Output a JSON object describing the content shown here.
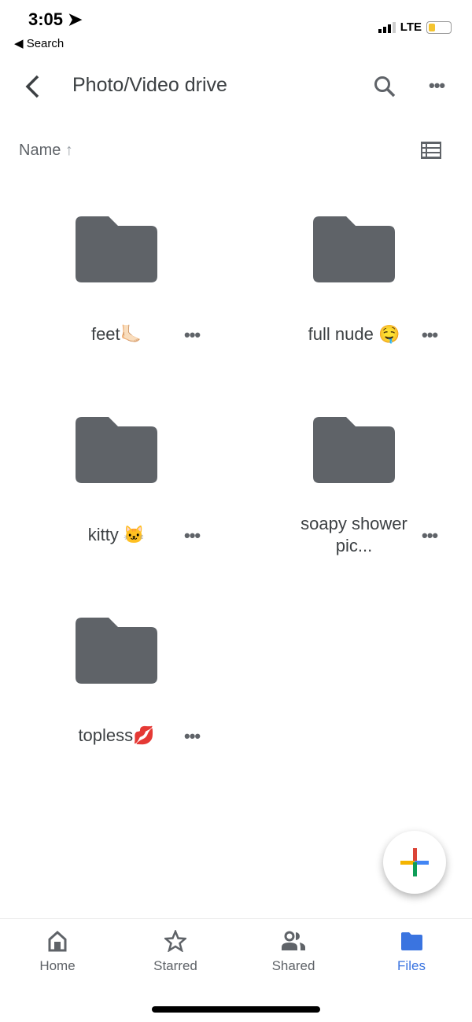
{
  "status_bar": {
    "time": "3:05",
    "back_app": "◀ Search",
    "network": "LTE",
    "battery_level": 0.25
  },
  "header": {
    "title": "Photo/Video drive"
  },
  "sort": {
    "label": "Name",
    "direction": "ascending"
  },
  "folders": [
    {
      "name": "feet🦶🏻"
    },
    {
      "name": "full nude 🤤"
    },
    {
      "name": "kitty 🐱"
    },
    {
      "name": "soapy shower pic..."
    },
    {
      "name": "topless💋"
    }
  ],
  "colors": {
    "folder": "#5f6368",
    "active": "#3a74e0"
  },
  "bottom_nav": {
    "items": [
      {
        "label": "Home"
      },
      {
        "label": "Starred"
      },
      {
        "label": "Shared"
      },
      {
        "label": "Files",
        "active": true
      }
    ]
  }
}
